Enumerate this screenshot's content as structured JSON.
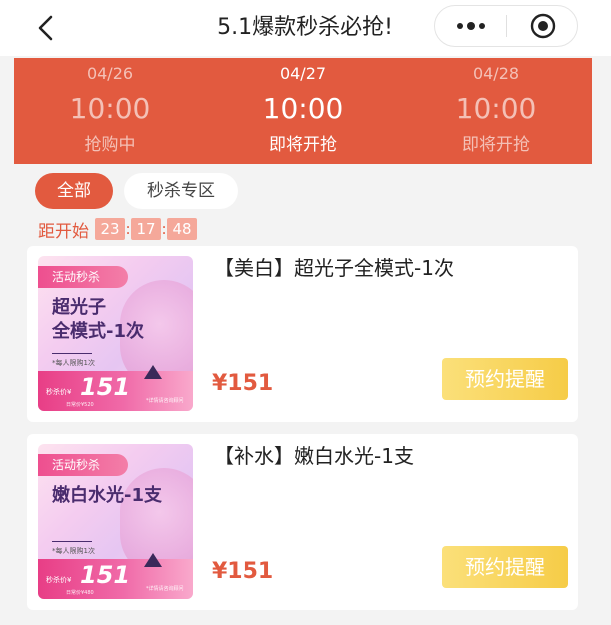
{
  "header": {
    "title": "5.1爆款秒杀必抢!"
  },
  "banner": {
    "slots": [
      {
        "date": "04/26",
        "time": "10:00",
        "status": "抢购中"
      },
      {
        "date": "04/27",
        "time": "10:00",
        "status": "即将开抢"
      },
      {
        "date": "04/28",
        "time": "10:00",
        "status": "即将开抢"
      }
    ],
    "active_index": 1
  },
  "tabs": [
    {
      "label": "全部"
    },
    {
      "label": "秒杀专区"
    }
  ],
  "countdown": {
    "label": "距开始",
    "hours": "23",
    "minutes": "17",
    "seconds": "48"
  },
  "products": [
    {
      "name": "【美白】超光子全模式-1次",
      "price": "¥151",
      "button": "预约提醒",
      "thumb": {
        "tag": "活动秒杀",
        "title_line1": "超光子",
        "title_line2": "全模式-1次",
        "limit": "*每人限购1次",
        "price_label": "秒杀价¥",
        "price": "151",
        "sub": "日常价¥520",
        "note": "*详情请咨询顾问"
      }
    },
    {
      "name": "【补水】嫩白水光-1支",
      "price": "¥151",
      "button": "预约提醒",
      "thumb": {
        "tag": "活动秒杀",
        "title_line1": "嫩白水光-1支",
        "title_line2": "",
        "limit": "*每人限购1次",
        "price_label": "秒杀价¥",
        "price": "151",
        "sub": "日常价¥480",
        "note": "*详情请咨询顾问"
      }
    }
  ],
  "colors": {
    "accent": "#e25a3f",
    "button_gold": "#f6cc47"
  },
  "icons": {
    "back": "chevron-left-icon",
    "more": "more-dots-icon",
    "close": "target-close-icon"
  }
}
